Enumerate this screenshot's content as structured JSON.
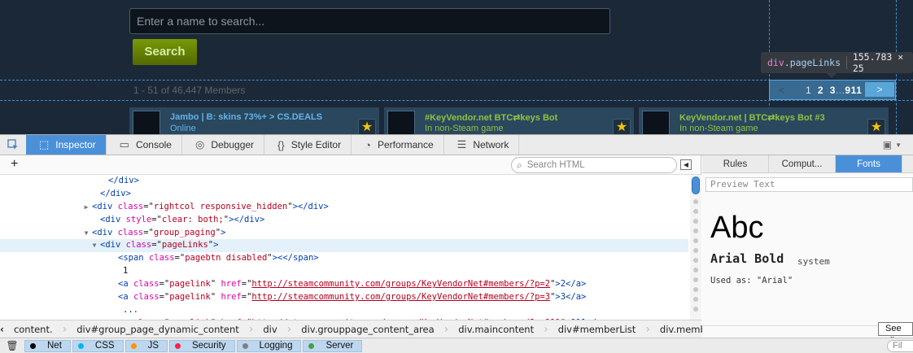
{
  "page": {
    "search_placeholder": "Enter a name to search...",
    "search_button": "Search",
    "member_count": "1 - 51 of 46,447 Members",
    "paging": {
      "prev": "<",
      "pages": [
        "1",
        "2",
        "3"
      ],
      "ellipsis": "...",
      "last": "911",
      "next": ">"
    },
    "tooltip": {
      "tag": "div",
      "class": ".pageLinks",
      "dimensions": "155.783 × 25"
    },
    "members": [
      {
        "name": "Jambo | B: skins 73%+ > CS.DEALS",
        "status": "Online",
        "state": "online"
      },
      {
        "name": "#KeyVendor.net BTC⇄keys Bot",
        "status": "In non-Steam game",
        "state": "in-game"
      },
      {
        "name": "KeyVendor.net | BTC⇄keys Bot #3",
        "status": "In non-Steam game",
        "state": "in-game"
      }
    ],
    "colors": {
      "bg": "#1b2838",
      "online": "#62b4e6",
      "in_game": "#8fc141",
      "accent": "#4a90d9"
    }
  },
  "devtools": {
    "tabs": [
      {
        "label": "Inspector",
        "icon": "inspector-icon",
        "active": true
      },
      {
        "label": "Console",
        "icon": "console-icon"
      },
      {
        "label": "Debugger",
        "icon": "debugger-icon"
      },
      {
        "label": "Style Editor",
        "icon": "style-editor-icon"
      },
      {
        "label": "Performance",
        "icon": "performance-icon"
      },
      {
        "label": "Network",
        "icon": "network-icon"
      }
    ],
    "markup": {
      "search_placeholder": "Search HTML",
      "lines": [
        {
          "indent": 0,
          "kind": "close",
          "text": "</div>"
        },
        {
          "indent": 1,
          "kind": "close",
          "text": "</div>"
        },
        {
          "indent": 1,
          "kind": "el",
          "twisty": "▶",
          "tag": "div",
          "attr": "class",
          "val": "rightcol responsive_hidden",
          "tail": "></div>"
        },
        {
          "indent": 1,
          "kind": "el",
          "tag": "div",
          "attr": "style",
          "val": "clear: both;",
          "tail": "></div>"
        },
        {
          "indent": 1,
          "kind": "el",
          "twisty": "▼",
          "tag": "div",
          "attr": "class",
          "val": "group_paging",
          "tail": ">"
        },
        {
          "indent": 2,
          "kind": "el",
          "twisty": "▼",
          "tag": "div",
          "attr": "class",
          "val": "pageLinks",
          "tail": ">",
          "selected": true
        },
        {
          "indent": 3,
          "kind": "el",
          "tag": "span",
          "attr": "class",
          "val": "pagebtn disabled",
          "tail": "><</span>"
        },
        {
          "indent": 3,
          "kind": "text",
          "text": "1"
        },
        {
          "indent": 3,
          "kind": "link",
          "tag": "a",
          "attr": "class",
          "val": "pagelink",
          "href": "http://steamcommunity.com/groups/KeyVendorNet#members/?p=2",
          "tail": ">2</a>"
        },
        {
          "indent": 3,
          "kind": "link",
          "tag": "a",
          "attr": "class",
          "val": "pagelink",
          "href": "http://steamcommunity.com/groups/KeyVendorNet#members/?p=3",
          "tail": ">3</a>"
        },
        {
          "indent": 3,
          "kind": "text",
          "text": "..."
        },
        {
          "indent": 3,
          "kind": "link",
          "tag": "a",
          "attr": "class",
          "val": "pagelink",
          "href": "http://steamcommunity.com/groups/KeyVendorNet#members/?p=911",
          "tail": ">911</a>"
        }
      ]
    },
    "breadcrumbs": [
      "content.",
      "div#group_page_dynamic_content",
      "div",
      "div.grouppage_content_area",
      "div.maincontent",
      "div#memberList",
      "div.membe"
    ],
    "sidebar": {
      "tabs": [
        {
          "label": "Rules"
        },
        {
          "label": "Comput..."
        },
        {
          "label": "Fonts",
          "active": true
        }
      ],
      "preview_placeholder": "Preview Text",
      "preview": "Abc",
      "font_name": "Arial Bold",
      "font_origin": "system",
      "used_as": "Used as: \"Arial\"",
      "see_all": "See all"
    },
    "console_filters": [
      {
        "label": "Net",
        "color": "#000000"
      },
      {
        "label": "CSS",
        "color": "#00b6f0"
      },
      {
        "label": "JS",
        "color": "#fb9500"
      },
      {
        "label": "Security",
        "color": "#ff2050"
      },
      {
        "label": "Logging",
        "color": "#808080"
      },
      {
        "label": "Server",
        "color": "#4a9d4a"
      }
    ],
    "filter_placeholder": "Fil"
  }
}
